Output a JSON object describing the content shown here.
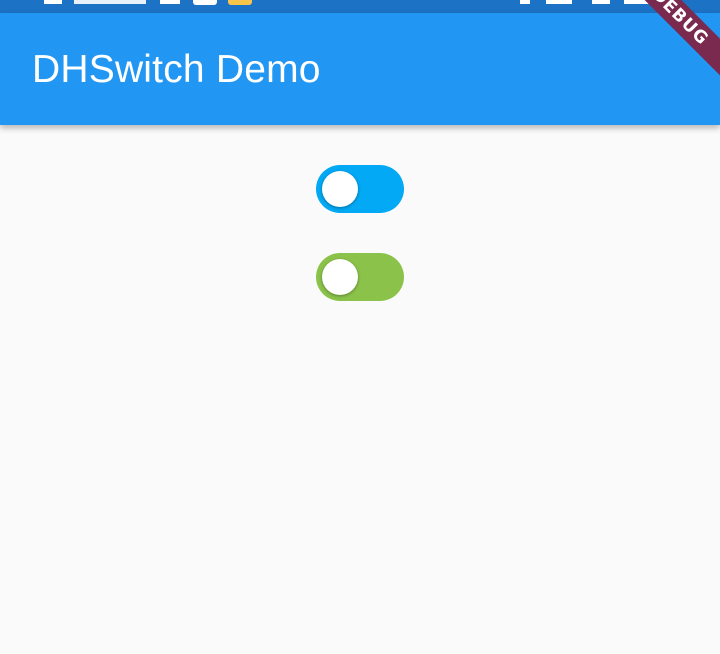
{
  "app_bar": {
    "title": "DHSwitch Demo",
    "background": "#2196f3"
  },
  "status_bar": {
    "background": "#1c72c4"
  },
  "debug_banner": {
    "label": "DEBUG",
    "color": "#7a2a4f"
  },
  "switches": [
    {
      "state": "off",
      "track_color": "#03a9f4",
      "thumb_color": "#ffffff"
    },
    {
      "state": "off",
      "track_color": "#8bc34a",
      "thumb_color": "#ffffff"
    }
  ]
}
